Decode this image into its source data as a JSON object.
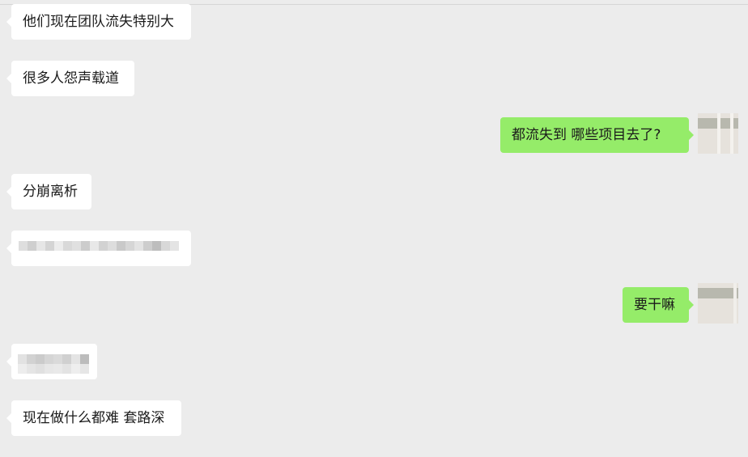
{
  "messages": [
    {
      "side": "left",
      "text": "他们现在团队流失特别大"
    },
    {
      "side": "left",
      "text": "很多人怨声载道"
    },
    {
      "side": "right",
      "text": "都流失到  哪些项目去了?",
      "avatar": "user-avatar"
    },
    {
      "side": "left",
      "text": "分崩离析"
    },
    {
      "side": "left",
      "text": "",
      "note": "pixelated"
    },
    {
      "side": "right",
      "text": "要干嘛",
      "avatar": "user-avatar"
    },
    {
      "side": "left",
      "text": "",
      "note": "pixelated"
    },
    {
      "side": "left",
      "text": "现在做什么都难 套路深"
    }
  ],
  "colors": {
    "background": "#ececec",
    "incoming_bubble": "#ffffff",
    "outgoing_bubble": "#95ec69"
  }
}
